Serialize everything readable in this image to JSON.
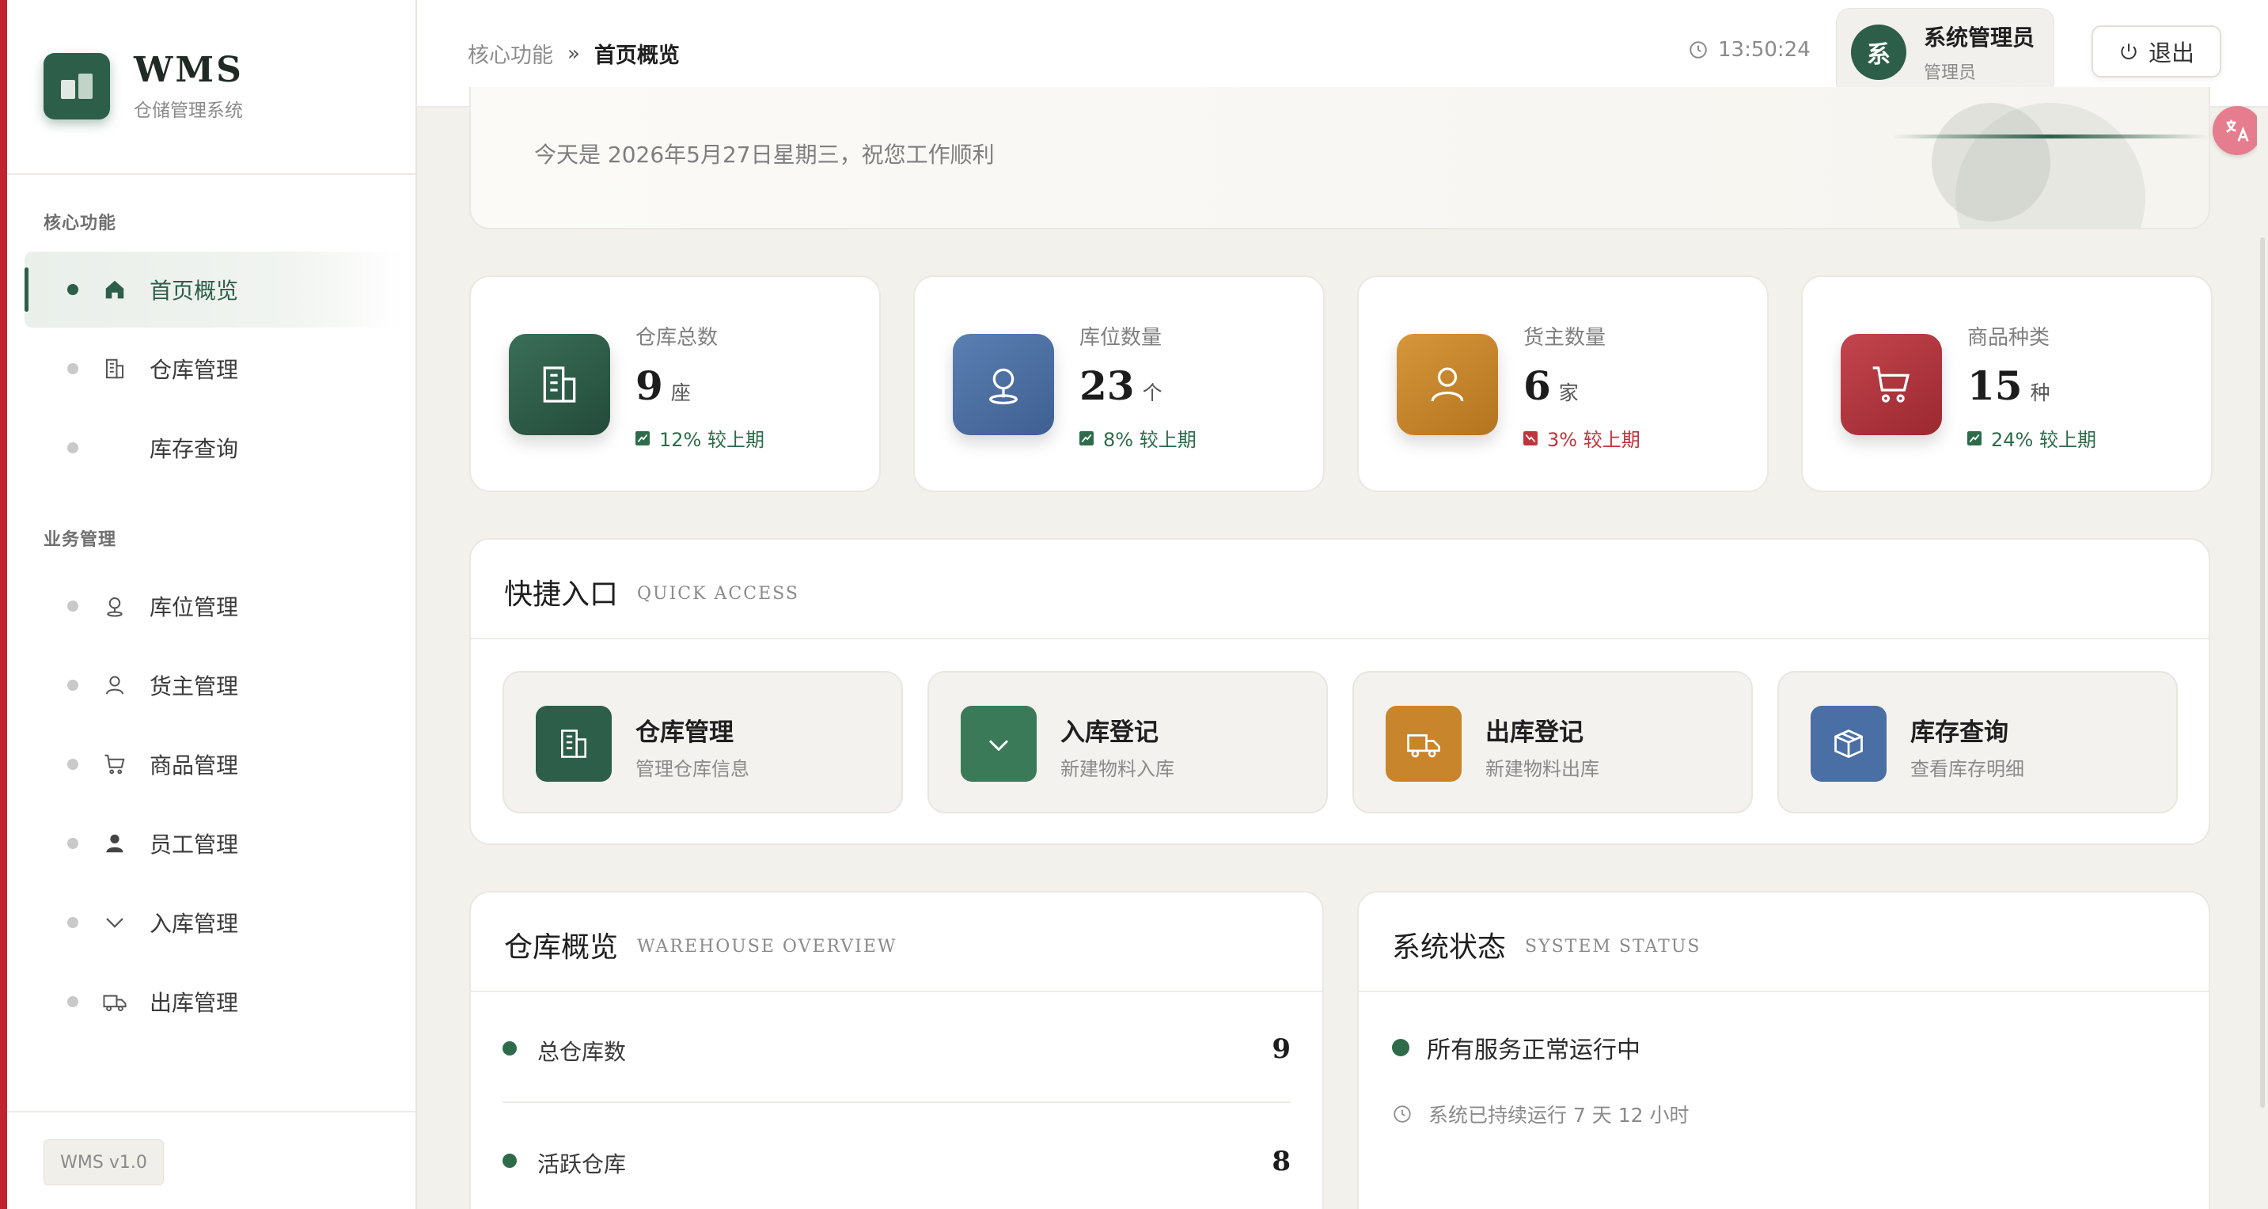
{
  "app": {
    "name": "WMS",
    "subtitle": "仓储管理系统",
    "version": "WMS v1.0",
    "accent_color": "#2d5e49",
    "brand_red": "#c0242f"
  },
  "sidebar": {
    "groups": [
      {
        "title": "核心功能",
        "items": [
          {
            "label": "首页概览",
            "icon": "home-icon",
            "active": true
          },
          {
            "label": "仓库管理",
            "icon": "building-icon",
            "active": false
          },
          {
            "label": "库存查询",
            "icon": "",
            "active": false
          }
        ]
      },
      {
        "title": "业务管理",
        "items": [
          {
            "label": "库位管理",
            "icon": "location-pin-icon",
            "active": false
          },
          {
            "label": "货主管理",
            "icon": "user-outline-icon",
            "active": false
          },
          {
            "label": "商品管理",
            "icon": "cart-icon",
            "active": false
          },
          {
            "label": "员工管理",
            "icon": "user-filled-icon",
            "active": false
          },
          {
            "label": "入库管理",
            "icon": "chevron-down-icon",
            "active": false
          },
          {
            "label": "出库管理",
            "icon": "truck-icon",
            "active": false
          }
        ]
      }
    ]
  },
  "header": {
    "breadcrumb_root": "核心功能",
    "breadcrumb_sep": "»",
    "breadcrumb_current": "首页概览",
    "time": "13:50:24",
    "user_avatar_text": "系",
    "user_name": "系统管理员",
    "user_role": "管理员",
    "logout_label": "退出"
  },
  "welcome": {
    "text": "今天是 2026年5月27日星期三，祝您工作顺利"
  },
  "stats": [
    {
      "label": "仓库总数",
      "value": "9",
      "unit": "座",
      "trend": "12% 较上期",
      "trend_dir": "up",
      "color": "#2d5e49",
      "icon": "building-icon"
    },
    {
      "label": "库位数量",
      "value": "23",
      "unit": "个",
      "trend": "8% 较上期",
      "trend_dir": "up",
      "color": "#4a6fa5",
      "icon": "location-pin-icon"
    },
    {
      "label": "货主数量",
      "value": "6",
      "unit": "家",
      "trend": "3% 较上期",
      "trend_dir": "down",
      "color": "#c9852c",
      "icon": "user-outline-icon"
    },
    {
      "label": "商品种类",
      "value": "15",
      "unit": "种",
      "trend": "24% 较上期",
      "trend_dir": "up",
      "color": "#b5323a",
      "icon": "cart-icon"
    }
  ],
  "quick_access": {
    "title": "快捷入口",
    "subtitle": "QUICK ACCESS",
    "items": [
      {
        "title": "仓库管理",
        "desc": "管理仓库信息",
        "color": "#2d5e49",
        "icon": "building-icon"
      },
      {
        "title": "入库登记",
        "desc": "新建物料入库",
        "color": "#3a7a58",
        "icon": "chevron-down-icon"
      },
      {
        "title": "出库登记",
        "desc": "新建物料出库",
        "color": "#c9852c",
        "icon": "truck-icon"
      },
      {
        "title": "库存查询",
        "desc": "查看库存明细",
        "color": "#4a6fa5",
        "icon": "box-icon"
      }
    ]
  },
  "warehouse_overview": {
    "title": "仓库概览",
    "subtitle": "WAREHOUSE OVERVIEW",
    "rows": [
      {
        "label": "总仓库数",
        "value": "9"
      },
      {
        "label": "活跃仓库",
        "value": "8"
      }
    ]
  },
  "system_status": {
    "title": "系统状态",
    "subtitle": "SYSTEM STATUS",
    "status_text": "所有服务正常运行中",
    "uptime_text": "系统已持续运行 7 天 12 小时"
  }
}
